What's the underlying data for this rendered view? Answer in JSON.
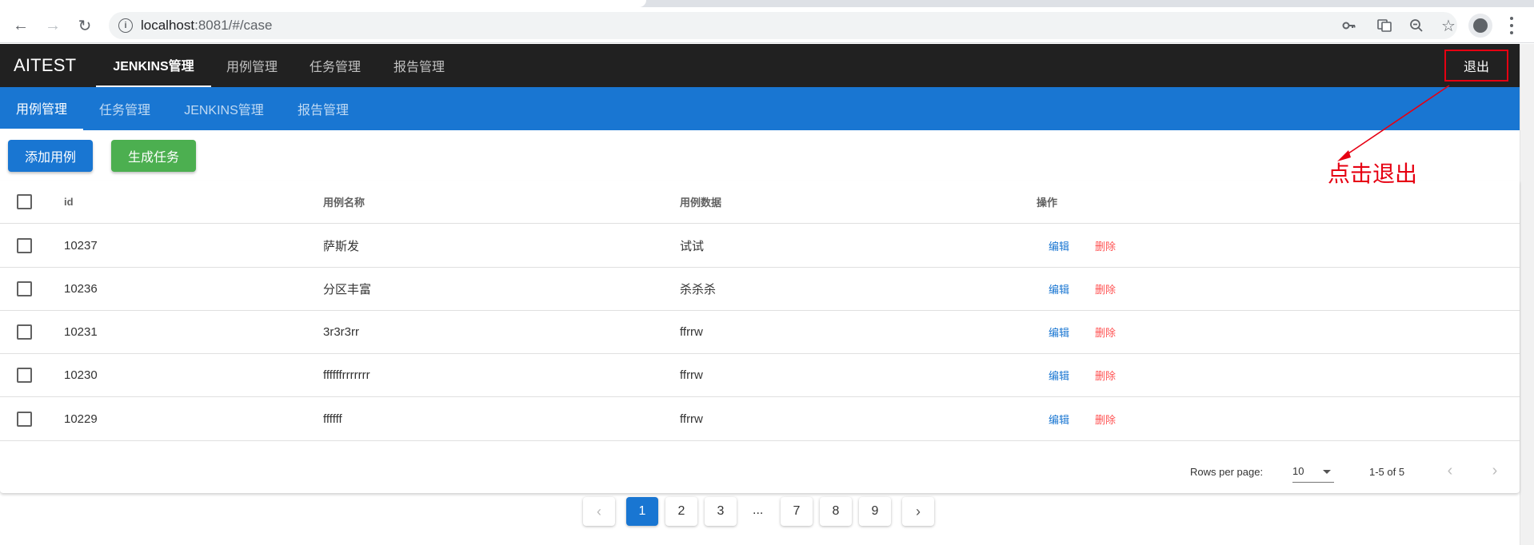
{
  "browser": {
    "url_host": "localhost",
    "url_path": ":8081/#/case"
  },
  "appbar": {
    "brand": "AITEST",
    "tabs": [
      {
        "label": "JENKINS管理",
        "active": true
      },
      {
        "label": "用例管理",
        "active": false
      },
      {
        "label": "任务管理",
        "active": false
      },
      {
        "label": "报告管理",
        "active": false
      }
    ],
    "logout_label": "退出"
  },
  "subbar": {
    "tabs": [
      {
        "label": "用例管理",
        "active": true
      },
      {
        "label": "任务管理",
        "active": false
      },
      {
        "label": "JENKINS管理",
        "active": false
      },
      {
        "label": "报告管理",
        "active": false
      }
    ]
  },
  "actions": {
    "add_label": "添加用例",
    "generate_label": "生成任务"
  },
  "table": {
    "headers": [
      "id",
      "用例名称",
      "用例数据",
      "操作"
    ],
    "rows": [
      {
        "id": "10237",
        "name": "萨斯发",
        "data": "试试"
      },
      {
        "id": "10236",
        "name": "分区丰富",
        "data": "杀杀杀"
      },
      {
        "id": "10231",
        "name": "3r3r3rr",
        "data": "ffrrw"
      },
      {
        "id": "10230",
        "name": "ffffffrrrrrrr",
        "data": "ffrrw"
      },
      {
        "id": "10229",
        "name": "ffffff",
        "data": "ffrrw"
      }
    ],
    "edit_label": "编辑",
    "delete_label": "删除",
    "footer": {
      "rows_per_page_label": "Rows per page:",
      "rows_per_page_value": "10",
      "range_text": "1-5 of 5"
    }
  },
  "pagination": {
    "pages": [
      "1",
      "2",
      "3",
      "7",
      "8",
      "9"
    ],
    "active": "1",
    "ellipsis": "..."
  },
  "annotation": {
    "text": "点击退出",
    "color": "#e60012"
  },
  "colors": {
    "primary": "#1976d2",
    "success": "#4caf50",
    "appbar": "#212121",
    "danger": "#ff5252"
  }
}
